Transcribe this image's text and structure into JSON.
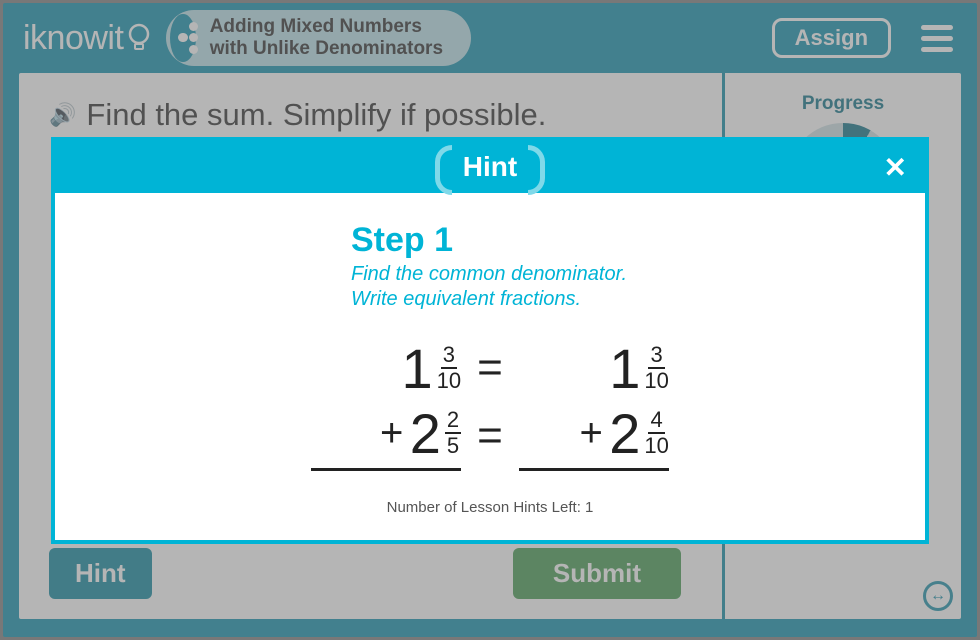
{
  "header": {
    "logo_text": "iknowit",
    "topic": "Adding Mixed Numbers with Unlike Denominators",
    "assign_label": "Assign"
  },
  "question": {
    "prompt": "Find the sum. Simplify if possible."
  },
  "actions": {
    "hint_label": "Hint",
    "submit_label": "Submit"
  },
  "sidebar": {
    "progress_label": "Progress"
  },
  "modal": {
    "title": "Hint",
    "step_label": "Step 1",
    "step_desc_line1": "Find the common denominator.",
    "step_desc_line2": "Write equivalent fractions.",
    "hints_left_text": "Number of Lesson Hints Left: 1",
    "equation": {
      "row1": {
        "left_whole": "1",
        "left_num": "3",
        "left_den": "10",
        "right_whole": "1",
        "right_num": "3",
        "right_den": "10"
      },
      "row2": {
        "op": "+",
        "left_whole": "2",
        "left_num": "2",
        "left_den": "5",
        "right_op": "+",
        "right_whole": "2",
        "right_num": "4",
        "right_den": "10"
      }
    }
  }
}
